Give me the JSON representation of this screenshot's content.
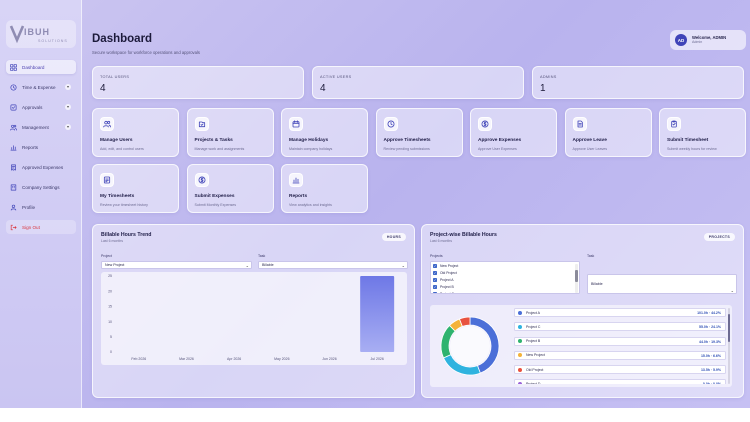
{
  "sidebar": {
    "logo_text": "VIBUH SOLUTIONS",
    "items": [
      {
        "label": "Dashboard",
        "icon": "dashboard-icon",
        "active": true
      },
      {
        "label": "Time & Expense",
        "icon": "clock-icon",
        "expandable": true
      },
      {
        "label": "Approvals",
        "icon": "check-icon",
        "expandable": true
      },
      {
        "label": "Management",
        "icon": "users-icon",
        "expandable": true
      },
      {
        "label": "Reports",
        "icon": "chart-icon"
      },
      {
        "label": "Approved Expenses",
        "icon": "receipt-icon"
      },
      {
        "label": "Company Settings",
        "icon": "building-icon"
      },
      {
        "label": "Profile",
        "icon": "user-icon"
      }
    ],
    "signout": {
      "label": "Sign Out",
      "icon": "logout-icon"
    }
  },
  "header": {
    "title": "Dashboard",
    "subtitle": "Secure workspace for workforce operations and approvals",
    "welcome": "Welcome, ADMIN",
    "role": "Admin",
    "avatar_initials": "AD"
  },
  "stats": [
    {
      "label": "TOTAL USERS",
      "value": "4"
    },
    {
      "label": "ACTIVE USERS",
      "value": "4"
    },
    {
      "label": "ADMINS",
      "value": "1"
    }
  ],
  "tiles": [
    {
      "title": "Manage Users",
      "desc": "Add, edit, and control users",
      "icon": "users-icon"
    },
    {
      "title": "Projects & Tasks",
      "desc": "Manage work and assignments",
      "icon": "projects-icon"
    },
    {
      "title": "Manage Holidays",
      "desc": "Maintain company holidays",
      "icon": "calendar-icon"
    },
    {
      "title": "Approve Timesheets",
      "desc": "Review pending submissions",
      "icon": "clock-icon"
    },
    {
      "title": "Approve Expenses",
      "desc": "Approve User Expenses",
      "icon": "dollar-icon"
    },
    {
      "title": "Approve Leave",
      "desc": "Approve User Leaves",
      "icon": "document-icon"
    },
    {
      "title": "Submit Timesheet",
      "desc": "Submit weekly hours for review",
      "icon": "clipboard-icon"
    },
    {
      "title": "My Timesheets",
      "desc": "Review your timesheet history",
      "icon": "timesheet-icon"
    },
    {
      "title": "Submit Expenses",
      "desc": "Submit Monthly Expenses",
      "icon": "dollar-icon"
    },
    {
      "title": "Reports",
      "desc": "View analytics and insights",
      "icon": "chart-icon"
    }
  ],
  "trend": {
    "title": "Billable Hours Trend",
    "subtitle": "Last 6 months",
    "badge": "HOURS",
    "project_label": "Project",
    "project_value": "New Project",
    "task_label": "Task",
    "task_value": "Billable"
  },
  "projectwise": {
    "title": "Project-wise Billable Hours",
    "subtitle": "Last 6 months",
    "badge": "PROJECTS",
    "projects_label": "Projects",
    "projects": [
      "New Project",
      "Old Project",
      "Project A",
      "Project B",
      "Project C"
    ],
    "task_label": "Task",
    "task_value": "Billable",
    "legend": [
      {
        "name": "Project A",
        "value": "101.0h · 44.2%",
        "color": "#4b6fd8"
      },
      {
        "name": "Project C",
        "value": "55.0h · 24.1%",
        "color": "#2fb3df"
      },
      {
        "name": "Project B",
        "value": "44.0h · 19.3%",
        "color": "#2fb36f"
      },
      {
        "name": "New Project",
        "value": "15.0h · 6.6%",
        "color": "#f4b23a"
      },
      {
        "name": "Old Project",
        "value": "13.5h · 5.9%",
        "color": "#e8523f"
      },
      {
        "name": "Project D",
        "value": "0.0h · 0.0%",
        "color": "#9a62d8"
      }
    ]
  },
  "chart_data": [
    {
      "type": "bar",
      "title": "Billable Hours Trend",
      "categories": [
        "Feb 2026",
        "Mar 2026",
        "Apr 2026",
        "May 2026",
        "Jun 2026",
        "Jul 2026"
      ],
      "values": [
        0,
        0,
        0,
        0,
        0,
        25
      ],
      "yticks": [
        0,
        5,
        10,
        15,
        20,
        25
      ],
      "ylim": [
        0,
        25
      ],
      "grid": false,
      "bar_color": "#7480e8"
    },
    {
      "type": "pie",
      "title": "Project-wise Billable Hours",
      "donut": true,
      "labels": [
        "Project A",
        "Project C",
        "Project B",
        "New Project",
        "Old Project"
      ],
      "values": [
        101.0,
        55.0,
        44.0,
        15.0,
        13.5
      ],
      "colors": [
        "#4b6fd8",
        "#2fb3df",
        "#2fb36f",
        "#f4b23a",
        "#e8523f"
      ]
    }
  ]
}
